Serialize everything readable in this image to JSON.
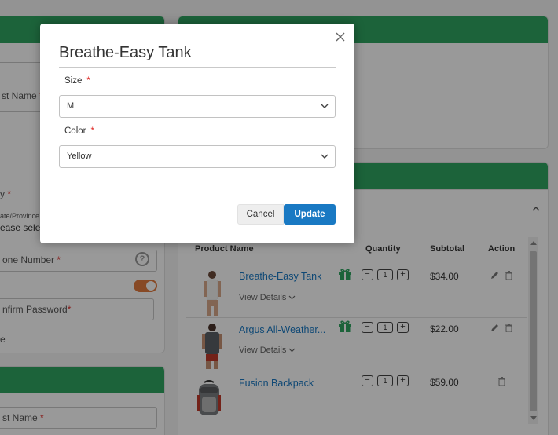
{
  "background": {
    "left_form": {
      "first_name_label": "st Name",
      "city_label": "y",
      "state_label": "ate/Province",
      "state_placeholder": "ease selec",
      "phone_label": "one Number",
      "help_icon": "question-circle-icon",
      "confirm_password_label": "nfirm Password",
      "stray_letter": "e",
      "second_first_name_label": "st Name",
      "required_mark": "*"
    },
    "cart": {
      "headers": {
        "product": "Product Name",
        "quantity": "Quantity",
        "subtotal": "Subtotal",
        "action": "Action"
      },
      "view_details": "View Details",
      "rows": [
        {
          "name": "Breathe-Easy Tank",
          "qty": "1",
          "subtotal": "$34.00",
          "has_gift": true,
          "has_edit": true
        },
        {
          "name": "Argus All-Weather...",
          "qty": "1",
          "subtotal": "$22.00",
          "has_gift": true,
          "has_edit": true
        },
        {
          "name": "Fusion Backpack",
          "qty": "1",
          "subtotal": "$59.00",
          "has_gift": false,
          "has_edit": false
        }
      ],
      "minus": "−",
      "plus": "+"
    },
    "colors": {
      "header_green": "#2fa562",
      "link_blue": "#1979c3",
      "toggle_orange": "#e27a3f"
    }
  },
  "modal": {
    "title": "Breathe-Easy Tank",
    "close_icon": "close-icon",
    "size": {
      "label": "Size",
      "required": "*",
      "value": "M"
    },
    "color": {
      "label": "Color",
      "required": "*",
      "value": "Yellow"
    },
    "cancel_label": "Cancel",
    "update_label": "Update",
    "colors": {
      "primary": "#1979c3",
      "required": "#e02b27"
    }
  }
}
